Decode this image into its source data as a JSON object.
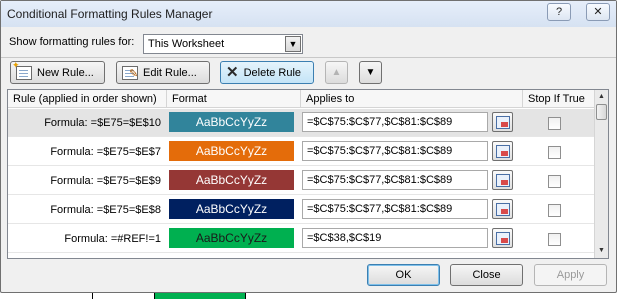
{
  "window": {
    "title": "Conditional Formatting Rules Manager",
    "help_symbol": "?",
    "close_symbol": "✕"
  },
  "show_rules": {
    "label": "Show formatting rules for:",
    "selected": "This Worksheet",
    "arrow": "▼"
  },
  "toolbar": {
    "new_rule": "New Rule...",
    "edit_rule": "Edit Rule...",
    "delete_rule": "Delete Rule",
    "move_up": "▲",
    "move_down": "▼"
  },
  "grid": {
    "headers": [
      "Rule (applied in order shown)",
      "Format",
      "Applies to",
      "Stop If True"
    ],
    "scroll_up": "▲",
    "scroll_down": "▼",
    "rows": [
      {
        "formula": "Formula: =$E75=$E$10",
        "preview": "AaBbCcYyZz",
        "color": "#31849b",
        "applies_to": "=$C$75:$C$77,$C$81:$C$89",
        "stop_if_true": false,
        "selected": true
      },
      {
        "formula": "Formula: =$E75=$E$7",
        "preview": "AaBbCcYyZz",
        "color": "#e46c0a",
        "applies_to": "=$C$75:$C$77,$C$81:$C$89",
        "stop_if_true": false,
        "selected": false
      },
      {
        "formula": "Formula: =$E75=$E$9",
        "preview": "AaBbCcYyZz",
        "color": "#953735",
        "applies_to": "=$C$75:$C$77,$C$81:$C$89",
        "stop_if_true": false,
        "selected": false
      },
      {
        "formula": "Formula: =$E75=$E$8",
        "preview": "AaBbCcYyZz",
        "color": "#002060",
        "applies_to": "=$C$75:$C$77,$C$81:$C$89",
        "stop_if_true": false,
        "selected": false
      },
      {
        "formula": "Formula: =#REF!=1",
        "preview": "AaBbCcYyZz",
        "color": "#00b050",
        "applies_to": "=$C$38,$C$19",
        "stop_if_true": false,
        "selected": false
      }
    ]
  },
  "buttons": {
    "ok": "OK",
    "close": "Close",
    "apply": "Apply"
  },
  "colors": {
    "title_bar": "#dbe6f4",
    "selected_row": "#e4e4e4",
    "active_button": "#c4e4f7"
  }
}
